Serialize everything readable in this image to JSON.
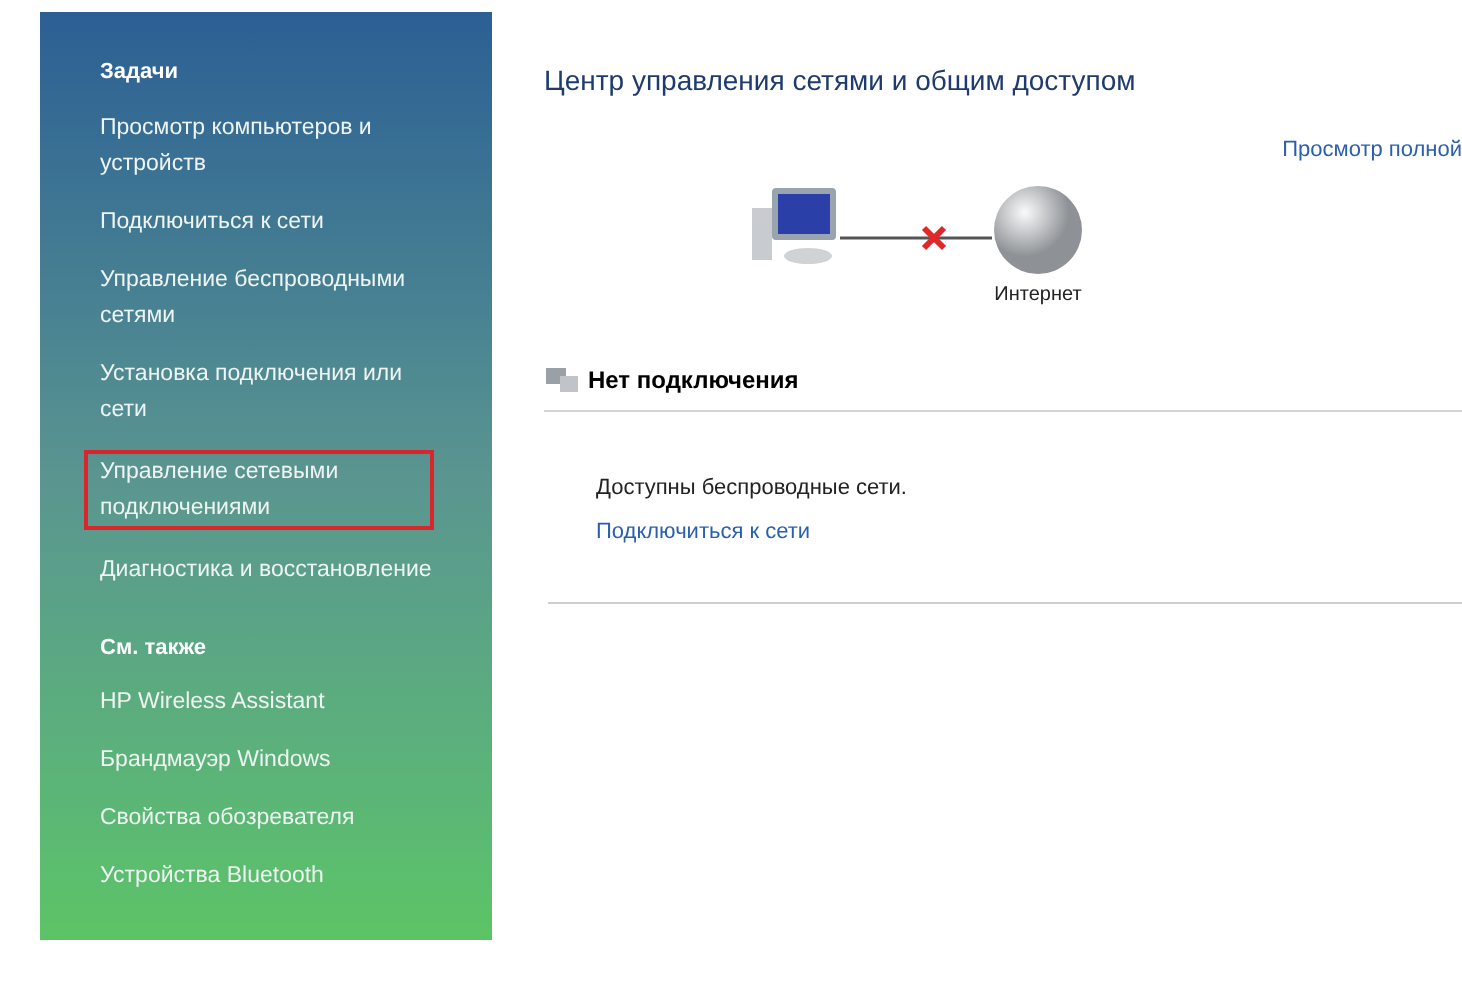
{
  "sidebar": {
    "sections": [
      {
        "title": "Задачи",
        "items": [
          {
            "label": "Просмотр компьютеров и устройств",
            "highlighted": false
          },
          {
            "label": "Подключиться к сети",
            "highlighted": false
          },
          {
            "label": "Управление беспроводными сетями",
            "highlighted": false
          },
          {
            "label": "Установка подключения или сети",
            "highlighted": false
          },
          {
            "label": "Управление сетевыми подключениями",
            "highlighted": true
          },
          {
            "label": "Диагностика и восстановление",
            "highlighted": false
          }
        ]
      },
      {
        "title": "См. также",
        "items": [
          {
            "label": "HP Wireless Assistant",
            "highlighted": false
          },
          {
            "label": "Брандмауэр Windows",
            "highlighted": false
          },
          {
            "label": "Свойства обозревателя",
            "highlighted": false
          },
          {
            "label": "Устройства Bluetooth",
            "highlighted": false
          }
        ]
      }
    ]
  },
  "main": {
    "title": "Центр управления сетями и общим доступом",
    "full_map_link": "Просмотр полной",
    "diagram": {
      "internet_label": "Интернет",
      "connected": false
    },
    "status": {
      "heading": "Нет подключения",
      "message": "Доступны беспроводные сети.",
      "link": "Подключиться к сети"
    }
  }
}
